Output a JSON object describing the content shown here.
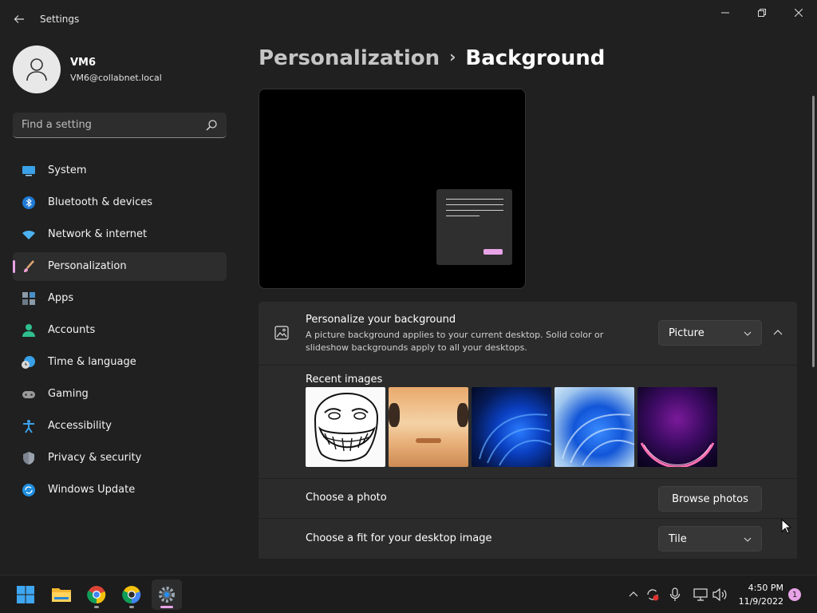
{
  "window": {
    "title": "Settings",
    "controls": [
      "minimize",
      "restore",
      "close"
    ]
  },
  "profile": {
    "name": "VM6",
    "email": "VM6@collabnet.local"
  },
  "search": {
    "placeholder": "Find a setting"
  },
  "sidebar": {
    "items": [
      {
        "label": "System",
        "icon": "system-icon",
        "active": false
      },
      {
        "label": "Bluetooth & devices",
        "icon": "bluetooth-icon",
        "active": false
      },
      {
        "label": "Network & internet",
        "icon": "wifi-icon",
        "active": false
      },
      {
        "label": "Personalization",
        "icon": "brush-icon",
        "active": true
      },
      {
        "label": "Apps",
        "icon": "apps-icon",
        "active": false
      },
      {
        "label": "Accounts",
        "icon": "accounts-icon",
        "active": false
      },
      {
        "label": "Time & language",
        "icon": "time-language-icon",
        "active": false
      },
      {
        "label": "Gaming",
        "icon": "gamepad-icon",
        "active": false
      },
      {
        "label": "Accessibility",
        "icon": "accessibility-icon",
        "active": false
      },
      {
        "label": "Privacy & security",
        "icon": "shield-icon",
        "active": false
      },
      {
        "label": "Windows Update",
        "icon": "update-icon",
        "active": false
      }
    ]
  },
  "breadcrumb": {
    "parent": "Personalization",
    "separator": "›",
    "current": "Background"
  },
  "background_card": {
    "title": "Personalize your background",
    "description": "A picture background applies to your current desktop. Solid color or slideshow backgrounds apply to all your desktops.",
    "type_value": "Picture",
    "recent_label": "Recent images",
    "recent_images": [
      "trollface-image",
      "blurred-face-image",
      "windows-bloom-dark-image",
      "windows-bloom-light-image",
      "purple-glow-image"
    ],
    "choose_photo_label": "Choose a photo",
    "browse_label": "Browse photos",
    "fit_label": "Choose a fit for your desktop image",
    "fit_value": "Tile"
  },
  "taskbar": {
    "apps": [
      "start-icon",
      "file-explorer-icon",
      "chrome-icon",
      "chrome-canary-icon",
      "settings-icon"
    ],
    "time": "4:50 PM",
    "date": "11/9/2022",
    "notifications": "1"
  },
  "colors": {
    "accent": "#e8a3e6",
    "background": "#202020",
    "card": "#2b2b2b"
  }
}
